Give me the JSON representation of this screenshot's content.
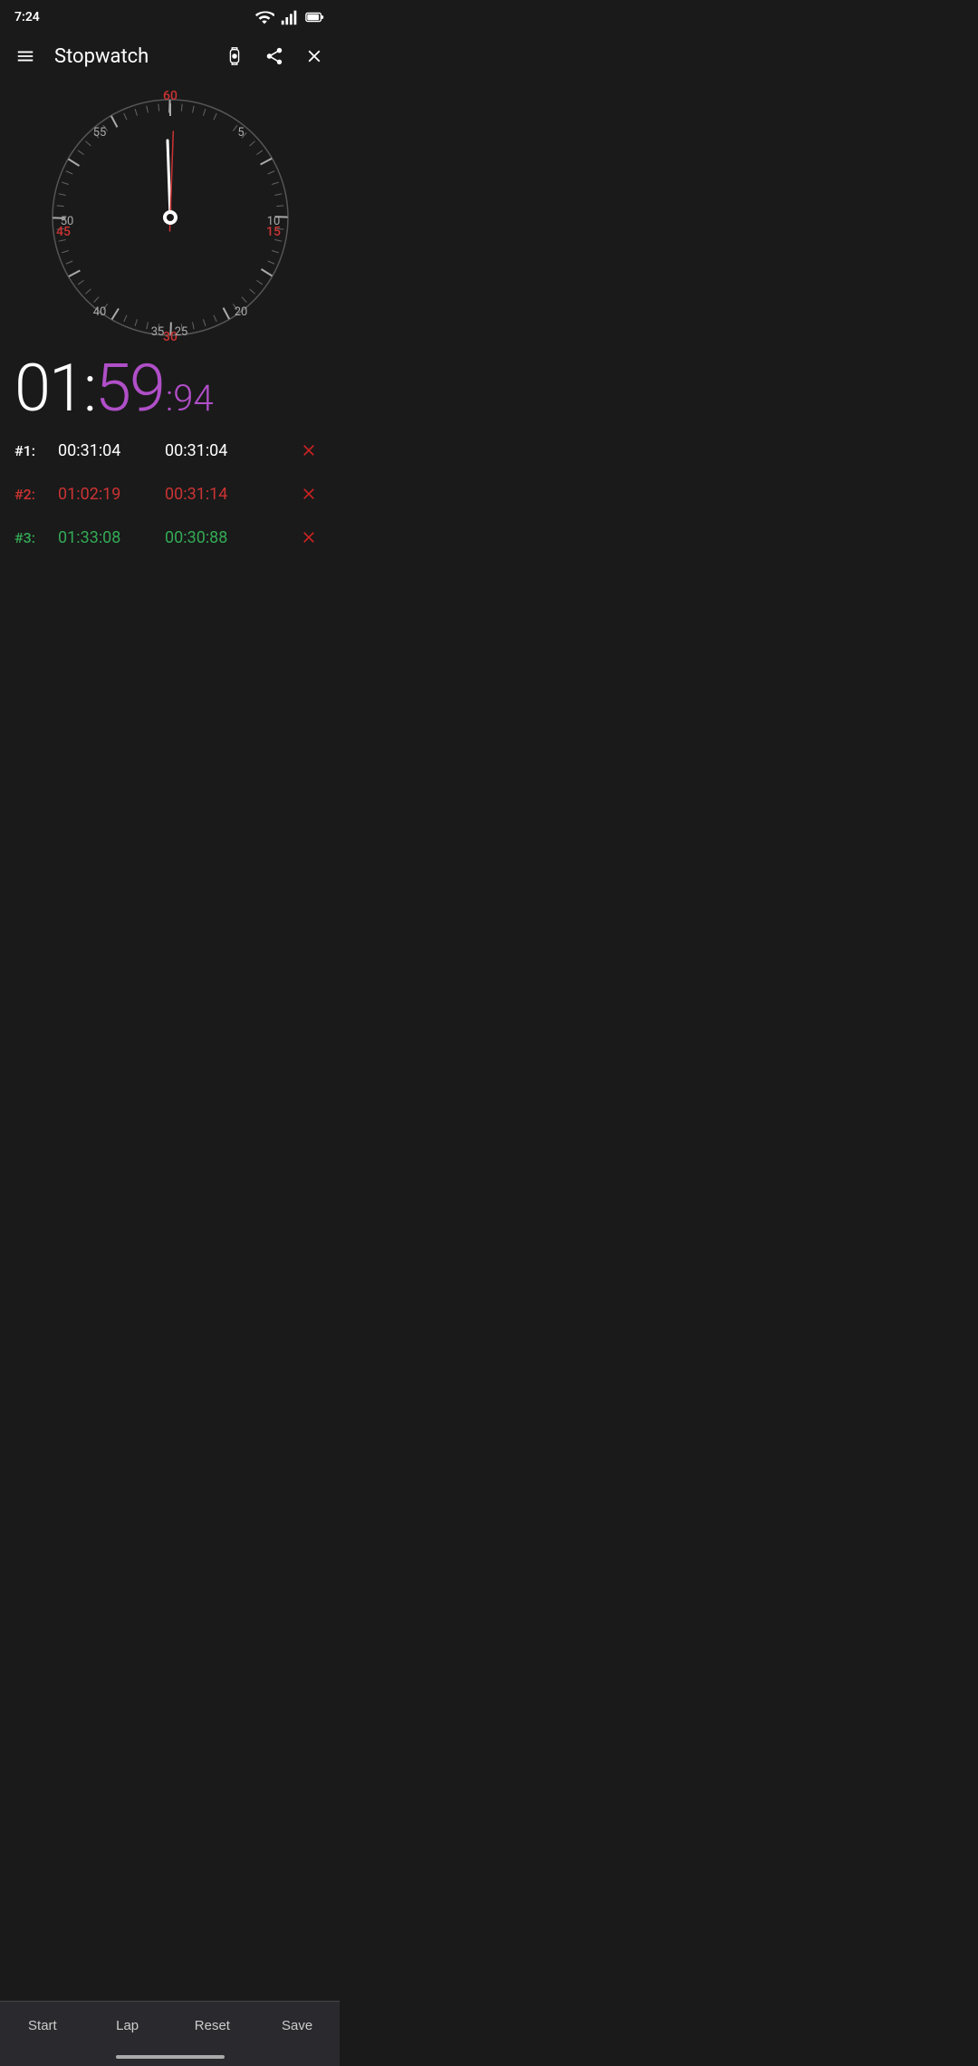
{
  "statusBar": {
    "time": "7:24",
    "icons": [
      "wifi",
      "signal",
      "battery"
    ]
  },
  "toolbar": {
    "title": "Stopwatch",
    "menuIcon": "menu-icon",
    "watchIcon": "watch-icon",
    "shareIcon": "share-icon",
    "closeIcon": "close-icon"
  },
  "clock": {
    "labels": [
      "60",
      "55",
      "5",
      "50",
      "10",
      "45",
      "15",
      "40",
      "20",
      "35",
      "25",
      "30"
    ],
    "handAngle": 358,
    "redHandAngle": 5
  },
  "timeDisplay": {
    "hours": "01",
    "separator": ":",
    "minutes": "59",
    "centiseconds": ":94"
  },
  "laps": [
    {
      "number": "#1:",
      "total": "00:31:04",
      "split": "00:31:04",
      "colorClass": "white"
    },
    {
      "number": "#2:",
      "total": "01:02:19",
      "split": "00:31:14",
      "colorClass": "red"
    },
    {
      "number": "#3:",
      "total": "01:33:08",
      "split": "00:30:88",
      "colorClass": "green"
    }
  ],
  "bottomNav": {
    "start": "Start",
    "lap": "Lap",
    "reset": "Reset",
    "save": "Save"
  }
}
